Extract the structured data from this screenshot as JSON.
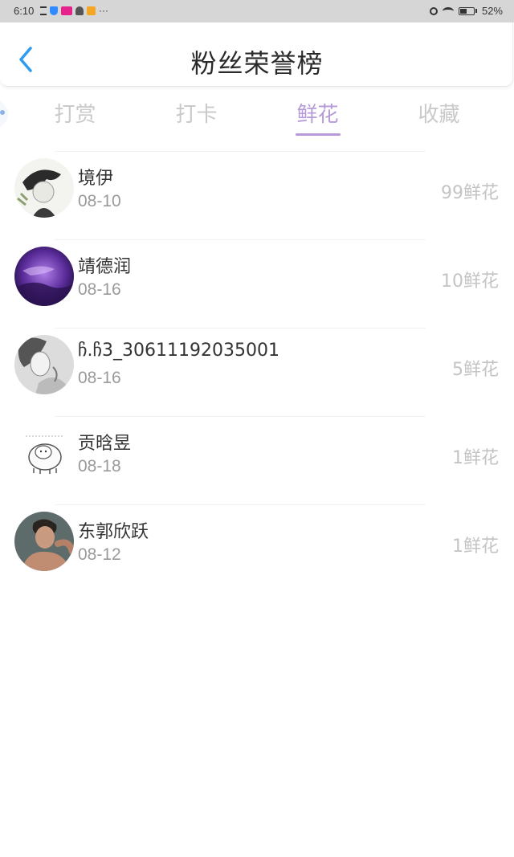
{
  "status_bar": {
    "time": "6:10",
    "more": "···",
    "battery": "52%",
    "battery_level": 0.52
  },
  "header": {
    "title": "粉丝荣誉榜",
    "back_icon": "chevron-left-icon",
    "accent_color": "#2f9bf0"
  },
  "tabs": [
    {
      "label": "打赏",
      "active": false
    },
    {
      "label": "打卡",
      "active": false
    },
    {
      "label": "鲜花",
      "active": true
    },
    {
      "label": "收藏",
      "active": false
    }
  ],
  "active_tab_color": "#b69ad9",
  "fans": [
    {
      "name": "境伊",
      "date": "08-10",
      "gift": "99鲜花",
      "avatar": "avatar-girl-sketch"
    },
    {
      "name": "靖德润",
      "date": "08-16",
      "gift": "10鲜花",
      "avatar": "avatar-purple-sky"
    },
    {
      "name": "ჩ.ჩ3_30611192035001",
      "date": "08-16",
      "gift": "5鲜花",
      "avatar": "avatar-grey-portrait"
    },
    {
      "name": "贡晗昱",
      "date": "08-18",
      "gift": "1鲜花",
      "avatar": "avatar-cartoon-sheep"
    },
    {
      "name": "东郭欣跃",
      "date": "08-12",
      "gift": "1鲜花",
      "avatar": "avatar-man-photo"
    }
  ]
}
